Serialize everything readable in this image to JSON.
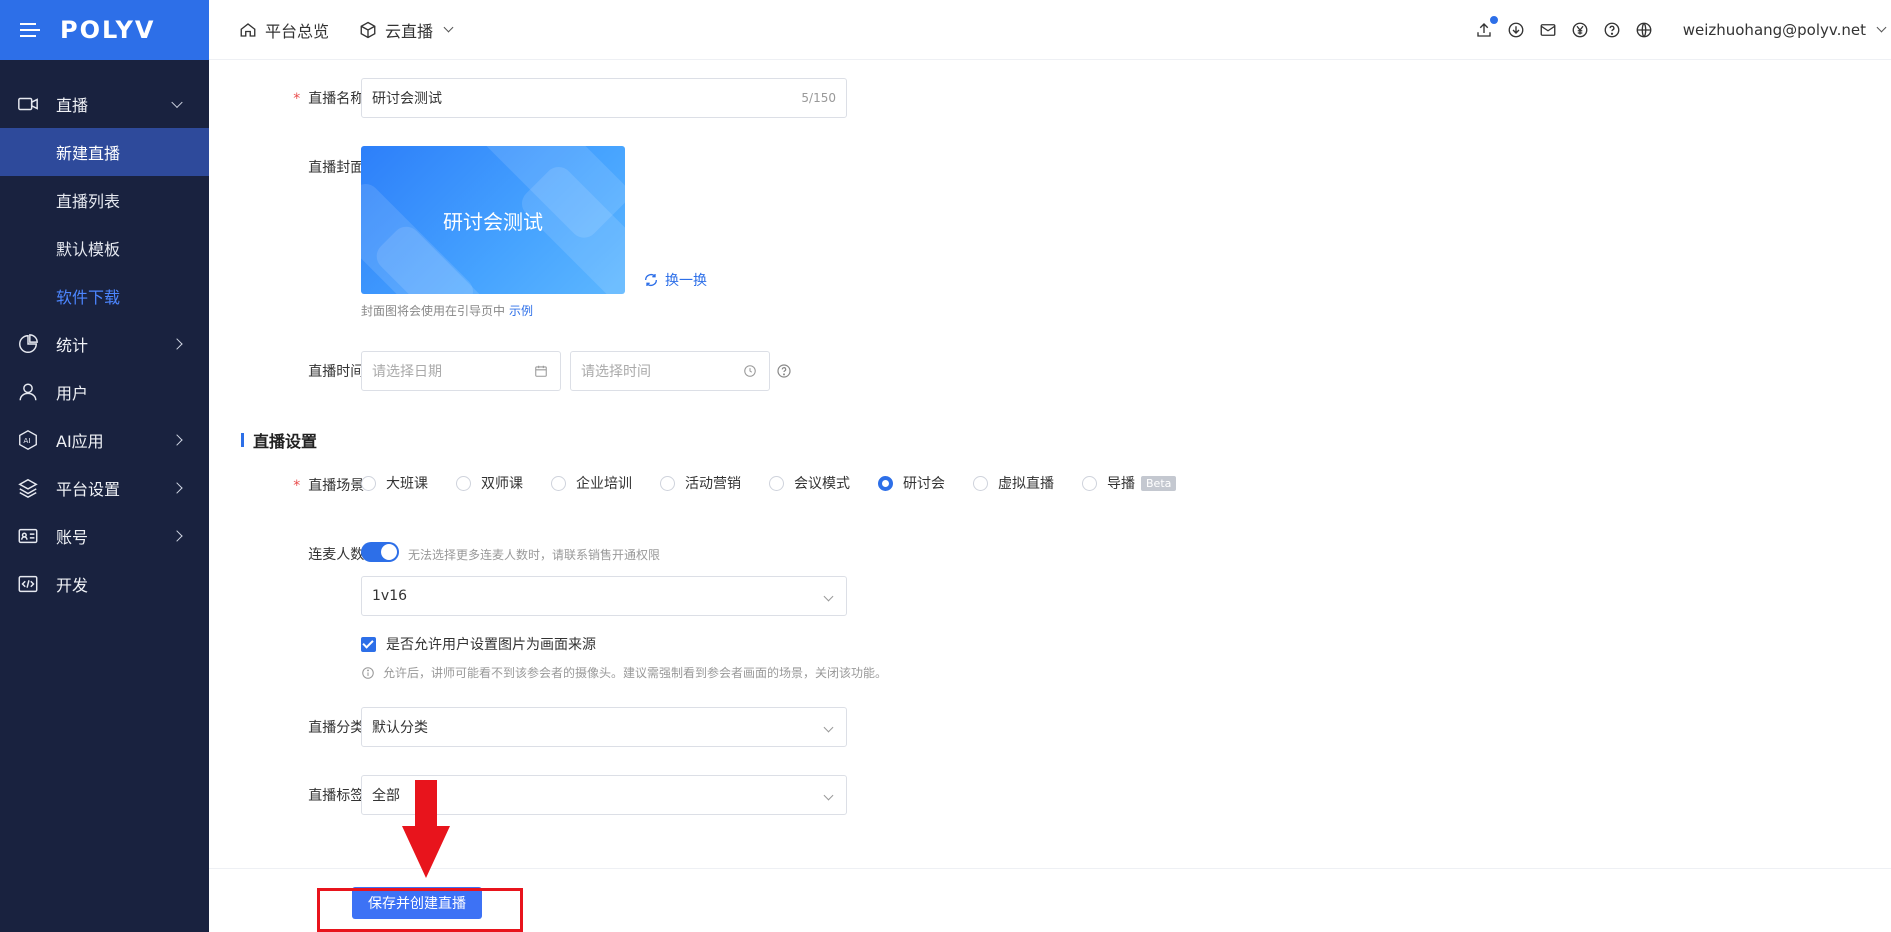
{
  "sidebar": {
    "logo": "POLYV",
    "items": [
      {
        "label": "直播"
      },
      {
        "label": "新建直播"
      },
      {
        "label": "直播列表"
      },
      {
        "label": "默认模板"
      },
      {
        "label": "软件下载"
      },
      {
        "label": "统计"
      },
      {
        "label": "用户"
      },
      {
        "label": "AI应用"
      },
      {
        "label": "平台设置"
      },
      {
        "label": "账号"
      },
      {
        "label": "开发"
      }
    ]
  },
  "topbar": {
    "tabs": [
      {
        "label": "平台总览"
      },
      {
        "label": "云直播"
      }
    ],
    "user_email": "weizhuohang@polyv.net"
  },
  "form": {
    "name_label": "直播名称:",
    "name_value": "研讨会测试",
    "name_counter": "5/150",
    "cover_label": "直播封面:",
    "cover_title": "研讨会测试",
    "swap_label": "换一换",
    "cover_tip": "封面图将会使用在引导页中",
    "cover_tip_link": "示例",
    "time_label": "直播时间:",
    "date_placeholder": "请选择日期",
    "time_placeholder": "请选择时间",
    "section_title": "直播设置",
    "scene_label": "直播场景:",
    "scenes": [
      {
        "label": "大班课",
        "checked": false
      },
      {
        "label": "双师课",
        "checked": false
      },
      {
        "label": "企业培训",
        "checked": false
      },
      {
        "label": "活动营销",
        "checked": false
      },
      {
        "label": "会议模式",
        "checked": false
      },
      {
        "label": "研讨会",
        "checked": true
      },
      {
        "label": "虚拟直播",
        "checked": false
      },
      {
        "label": "导播",
        "checked": false
      }
    ],
    "beta_badge": "Beta",
    "linkmic_label": "连麦人数:",
    "linkmic_hint": "无法选择更多连麦人数时，请联系销售开通权限",
    "linkmic_value": "1v16",
    "allow_image_label": "是否允许用户设置图片为画面来源",
    "allow_image_info": "允许后，讲师可能看不到该参会者的摄像头。建议需强制看到参会者画面的场景，关闭该功能。",
    "category_label": "直播分类:",
    "category_value": "默认分类",
    "tag_label": "直播标签:",
    "tag_value": "全部"
  },
  "footer": {
    "save_button": "保存并创建直播"
  },
  "colors": {
    "brand": "#2d6fe8",
    "sidebar_bg": "#19223f",
    "annotation": "#e8141c"
  }
}
